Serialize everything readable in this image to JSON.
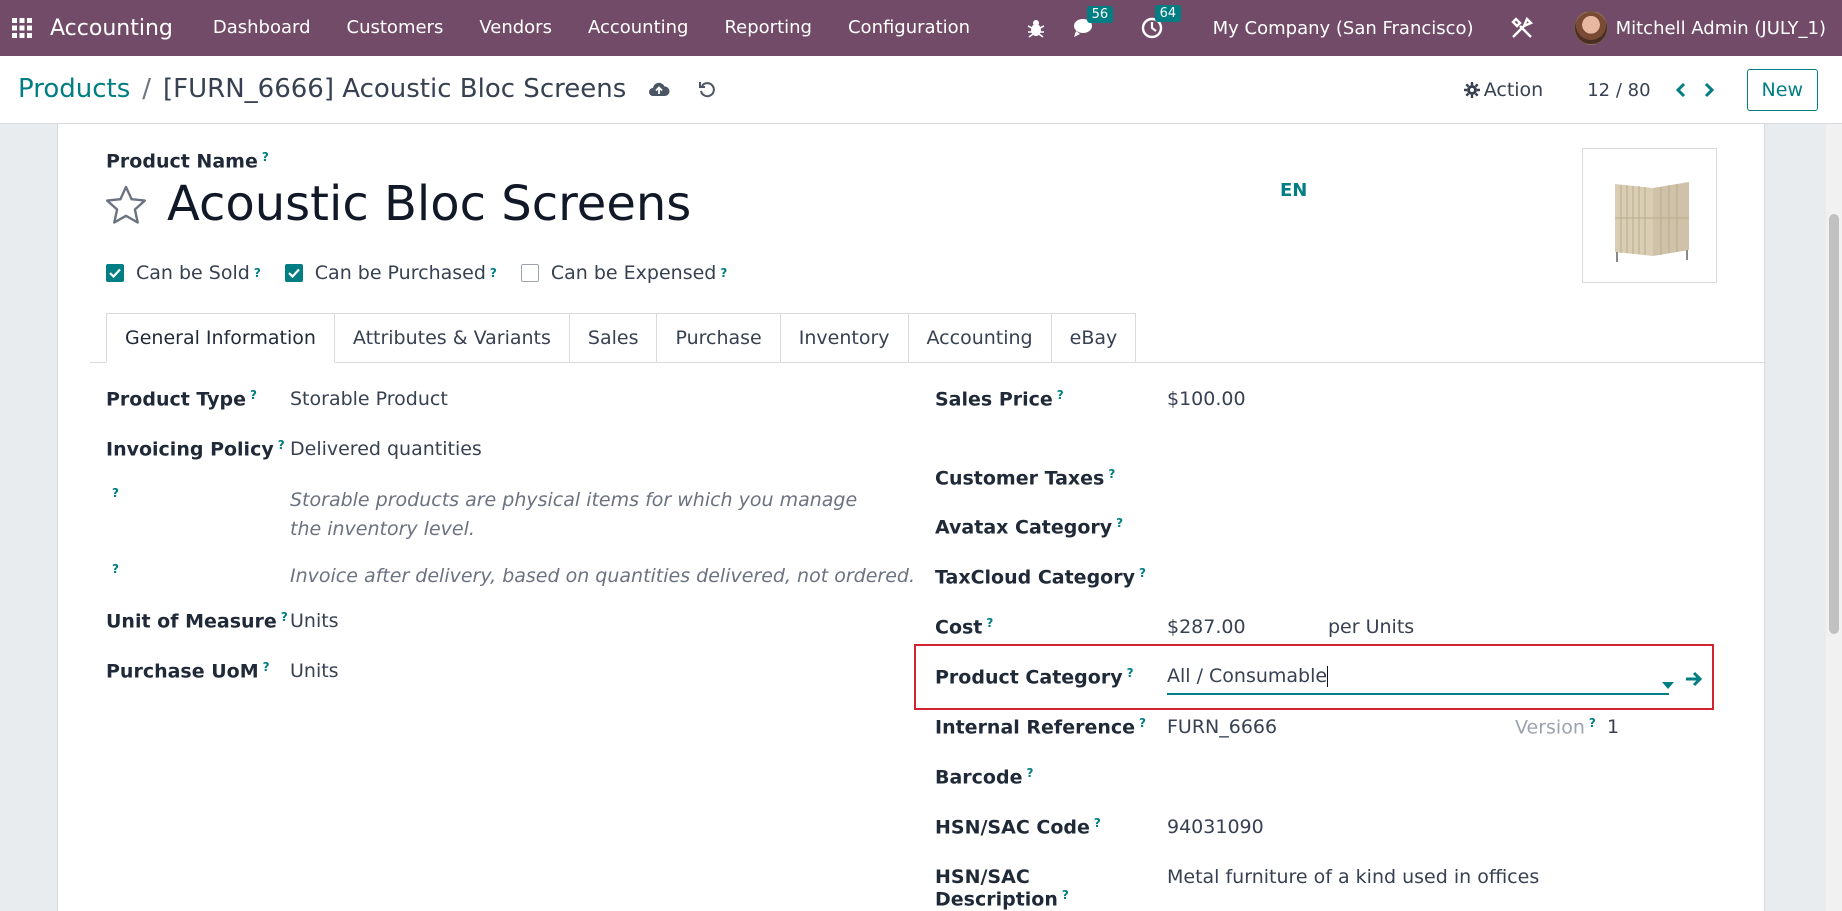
{
  "navbar": {
    "brand": "Accounting",
    "menu": [
      "Dashboard",
      "Customers",
      "Vendors",
      "Accounting",
      "Reporting",
      "Configuration"
    ],
    "messages_count": "56",
    "activities_count": "64",
    "company": "My Company (San Francisco)",
    "user": "Mitchell Admin (JULY_1)"
  },
  "control": {
    "breadcrumb_parent": "Products",
    "breadcrumb_sep": "/",
    "breadcrumb_current": "[FURN_6666] Acoustic Bloc Screens",
    "action_label": "Action",
    "pager": "12 / 80",
    "new_label": "New"
  },
  "form": {
    "product_name_label": "Product Name",
    "product_name": "Acoustic Bloc Screens",
    "lang": "EN",
    "checkboxes": [
      {
        "label": "Can be Sold",
        "checked": true
      },
      {
        "label": "Can be Purchased",
        "checked": true
      },
      {
        "label": "Can be Expensed",
        "checked": false
      }
    ],
    "tabs": [
      "General Information",
      "Attributes & Variants",
      "Sales",
      "Purchase",
      "Inventory",
      "Accounting",
      "eBay"
    ],
    "left": {
      "product_type_label": "Product Type",
      "product_type": "Storable Product",
      "invoicing_policy_label": "Invoicing Policy",
      "invoicing_policy": "Delivered quantities",
      "note1": "Storable products are physical items for which you manage the inventory level.",
      "note2": "Invoice after delivery, based on quantities delivered, not ordered.",
      "uom_label": "Unit of Measure",
      "uom": "Units",
      "purchase_uom_label": "Purchase UoM",
      "purchase_uom": "Units"
    },
    "right": {
      "sales_price_label": "Sales Price",
      "sales_price": "$100.00",
      "customer_taxes_label": "Customer Taxes",
      "avatax_label": "Avatax Category",
      "taxcloud_label": "TaxCloud Category",
      "cost_label": "Cost",
      "cost": "$287.00",
      "cost_unit": "per Units",
      "category_label": "Product Category",
      "category": "All / Consumable",
      "internal_ref_label": "Internal Reference",
      "internal_ref": "FURN_6666",
      "version_label": "Version",
      "version": "1",
      "barcode_label": "Barcode",
      "hsn_code_label": "HSN/SAC Code",
      "hsn_code": "94031090",
      "hsn_desc_label": "HSN/SAC Description",
      "hsn_desc": "Metal furniture of a kind used in offices"
    }
  },
  "colors": {
    "navbar": "#714b67",
    "accent": "#017e84",
    "highlight": "#d1242f"
  },
  "icons": [
    "apps-grid-icon",
    "bug-icon",
    "chat-icon",
    "clock-icon",
    "tools-icon",
    "cloud-upload-icon",
    "undo-icon",
    "gear-icon",
    "chevron-left-icon",
    "chevron-right-icon",
    "star-icon",
    "check-icon",
    "caret-down-icon",
    "arrow-right-icon"
  ]
}
